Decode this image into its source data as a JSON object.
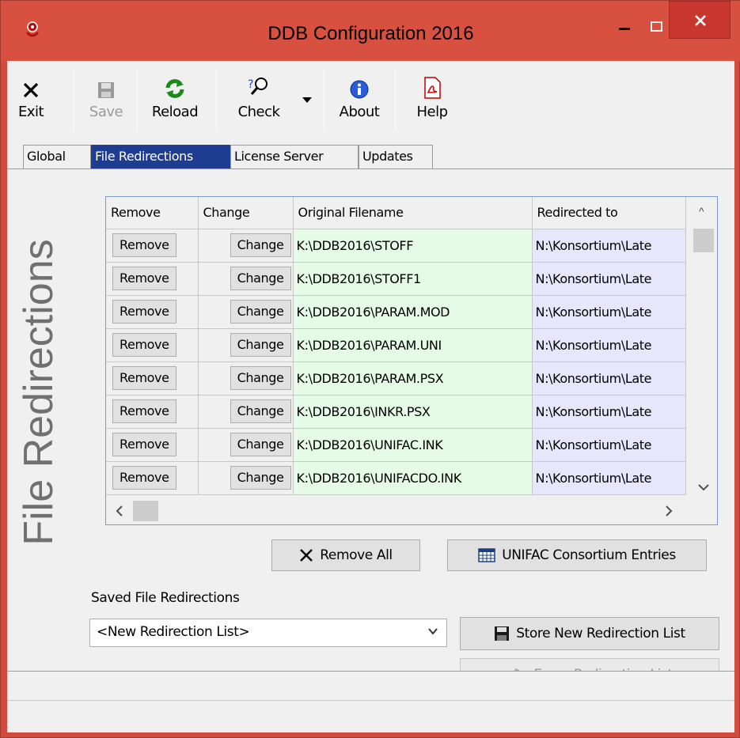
{
  "window": {
    "title": "DDB Configuration 2016",
    "accent_color": "#d8503f",
    "close_color": "#c7372f"
  },
  "toolbar": {
    "exit_label": "Exit",
    "save_label": "Save",
    "reload_label": "Reload",
    "check_label": "Check",
    "about_label": "About",
    "help_label": "Help"
  },
  "tabs": [
    {
      "label": "Global"
    },
    {
      "label": "File Redirections",
      "active": true
    },
    {
      "label": "License Server"
    },
    {
      "label": "Updates"
    }
  ],
  "panel": {
    "vertical_title": "File Redirections",
    "grid": {
      "columns": [
        "Remove",
        "Change",
        "Original Filename",
        "Redirected to"
      ],
      "rows": [
        {
          "remove": "Remove",
          "change": "Change",
          "original": "K:\\DDB2016\\STOFF",
          "redirected": "N:\\Konsortium\\Late"
        },
        {
          "remove": "Remove",
          "change": "Change",
          "original": "K:\\DDB2016\\STOFF1",
          "redirected": "N:\\Konsortium\\Late"
        },
        {
          "remove": "Remove",
          "change": "Change",
          "original": "K:\\DDB2016\\PARAM.MOD",
          "redirected": "N:\\Konsortium\\Late"
        },
        {
          "remove": "Remove",
          "change": "Change",
          "original": "K:\\DDB2016\\PARAM.UNI",
          "redirected": "N:\\Konsortium\\Late"
        },
        {
          "remove": "Remove",
          "change": "Change",
          "original": "K:\\DDB2016\\PARAM.PSX",
          "redirected": "N:\\Konsortium\\Late"
        },
        {
          "remove": "Remove",
          "change": "Change",
          "original": "K:\\DDB2016\\INKR.PSX",
          "redirected": "N:\\Konsortium\\Late"
        },
        {
          "remove": "Remove",
          "change": "Change",
          "original": "K:\\DDB2016\\UNIFAC.INK",
          "redirected": "N:\\Konsortium\\Late"
        },
        {
          "remove": "Remove",
          "change": "Change",
          "original": "K:\\DDB2016\\UNIFACDO.INK",
          "redirected": "N:\\Konsortium\\Late"
        }
      ],
      "original_bg": "#e6fbe6",
      "redirected_bg": "#e8e6fb"
    },
    "remove_all_label": "Remove All",
    "unifac_label": "UNIFAC Consortium Entries",
    "saved_label": "Saved File Redirections",
    "saved_select_value": "<New Redirection List>",
    "store_label": "Store New Redirection List",
    "erase_label": "Erase Redirection List"
  },
  "tab_active_color": "#1e3c90"
}
